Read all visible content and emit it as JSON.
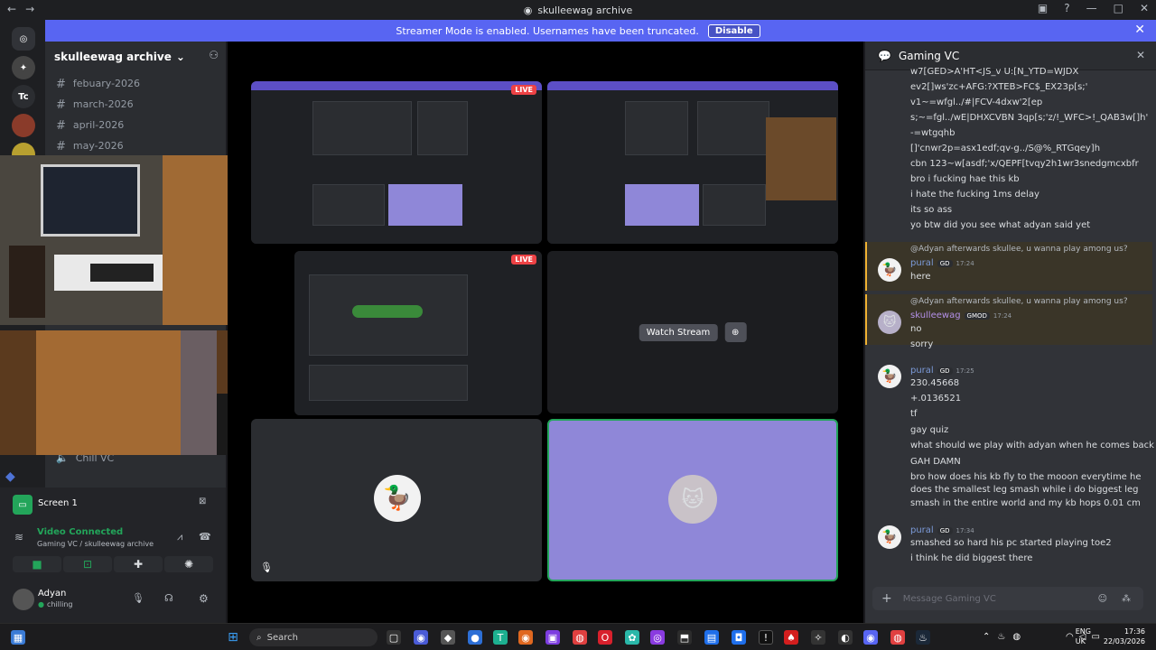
{
  "window": {
    "title": "skulleewag archive",
    "back": "←",
    "forward": "→"
  },
  "banner": {
    "text": "Streamer Mode is enabled. Usernames have been truncated.",
    "button": "Disable"
  },
  "guilds": [
    {
      "label": "Tc"
    }
  ],
  "server": {
    "name": "skulleewag archive"
  },
  "channels": [
    {
      "name": "febuary-2026"
    },
    {
      "name": "march-2026"
    },
    {
      "name": "april-2026"
    },
    {
      "name": "may-2026"
    }
  ],
  "voice_channel": {
    "name": "Chill VC"
  },
  "screenshare": {
    "label": "Screen 1"
  },
  "rtc": {
    "status": "Video Connected",
    "location": "Gaming VC / skulleewag archive"
  },
  "user": {
    "name": "Adyan",
    "status": "chilling"
  },
  "stream": {
    "live": "LIVE",
    "watch_label": "Watch Stream"
  },
  "chat": {
    "title": "Gaming VC",
    "top_lines": [
      "w7[GED>A'HT<JS_v U:[N_YTD=WJDX",
      "ev2[]ws'zc+AFG:?XTEB>FC$_EX23p[s;'",
      "v1~=wfgl../#|FCV-4dxw'2[ep",
      "s;~=fgl../wE|DHXCVBN 3qp[s;'z/!_WFC>!_QAB3w[]h'",
      "-=wtgqhb",
      "[]'cnwr2p=asx1edf;qv-g../S@%_RTGqey]h",
      "cbn 123~w[asdf;'x/QEPF[tvqy2h1wr3snedgmcxbfr",
      "bro i fucking hae this kb",
      "i hate the fucking 1ms delay",
      "its so ass",
      "yo btw did you see what adyan said yet"
    ],
    "reply_text": "@Adyan afterwards skullee, u wanna play among us?",
    "msg1": {
      "user": "pural",
      "badge": "GD",
      "time": "17:24",
      "lines": [
        "here"
      ]
    },
    "msg2": {
      "user": "skulleewag",
      "badge": "GMOD",
      "time": "17:24",
      "lines": [
        "no",
        "sorry"
      ]
    },
    "msg3": {
      "user": "pural",
      "badge": "GD",
      "time": "17:25",
      "lines": [
        "230.45668",
        "+.0136521",
        "tf",
        "gay quiz",
        "what should we play with adyan when he comes back",
        "GAH DAMN",
        "bro how does his kb fly to the mooon everytime he",
        "does the smallest leg smash while i do biggest leg",
        "smash in the entire world and my kb hops 0.01 cm"
      ]
    },
    "msg4": {
      "user": "pural",
      "badge": "GD",
      "time": "17:34",
      "lines": [
        "smashed so hard his pc started playing toe2",
        "i think he did biggest there"
      ]
    },
    "input_placeholder": "Message Gaming VC"
  },
  "taskbar": {
    "search": "Search",
    "lang1": "ENG",
    "lang2": "UK",
    "time": "17:36",
    "date": "22/03/2026"
  }
}
